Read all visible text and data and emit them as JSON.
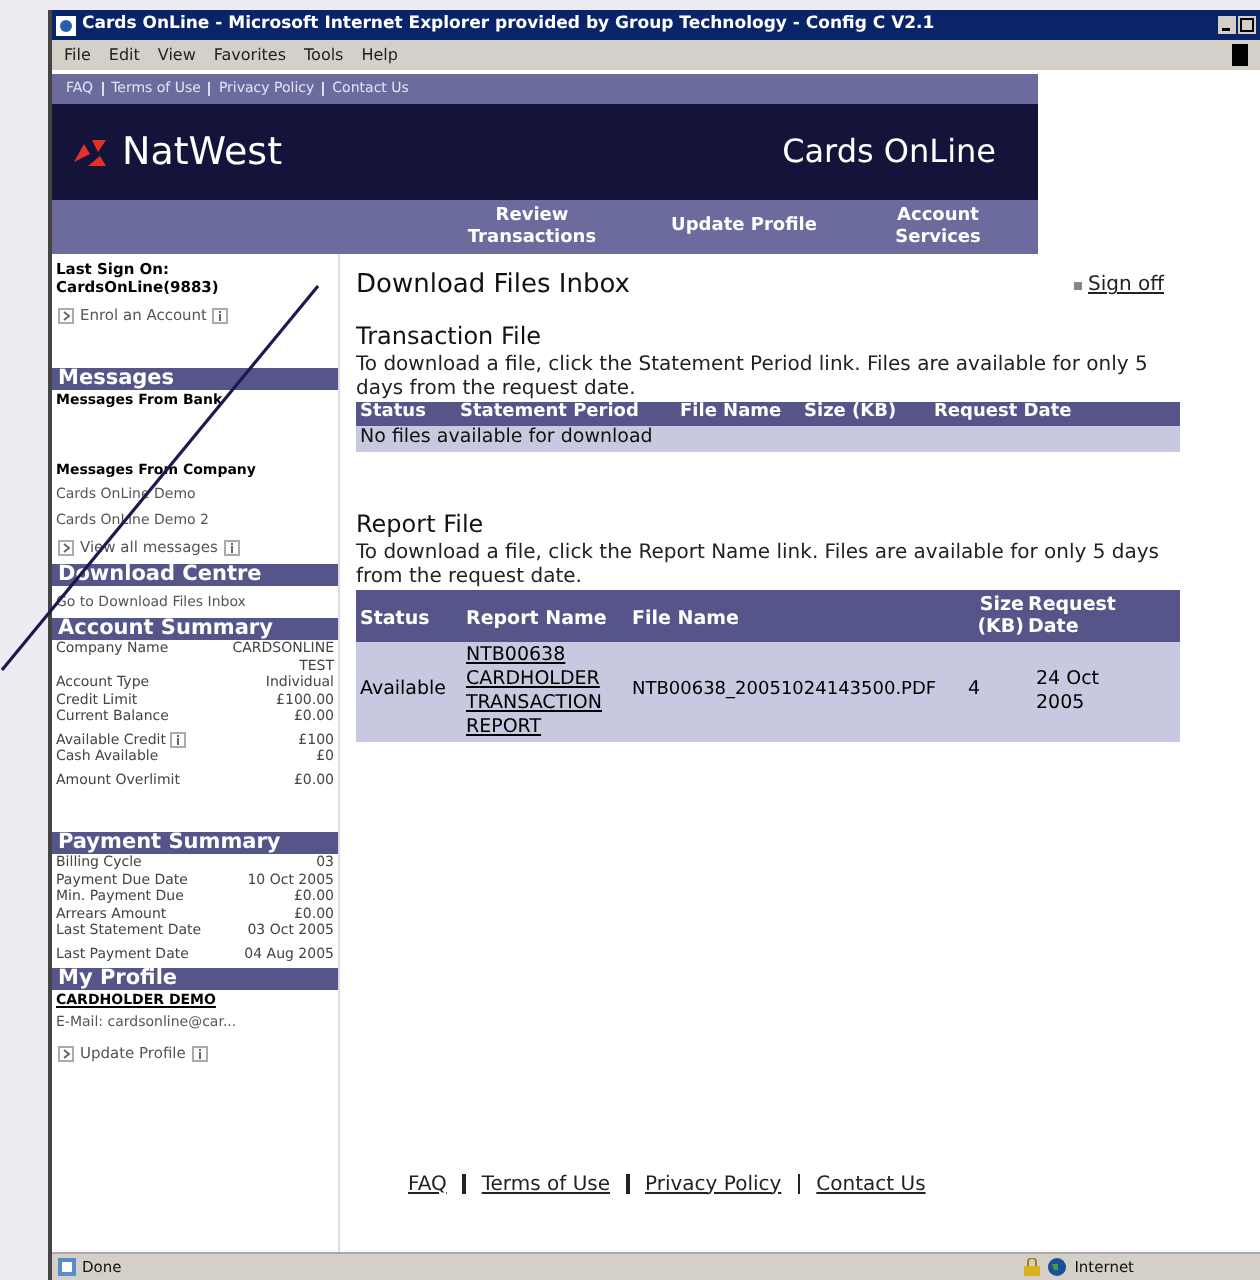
{
  "window": {
    "title": "Cards OnLine - Microsoft Internet Explorer provided by Group Technology - Config C V2.1",
    "menu": [
      "File",
      "Edit",
      "View",
      "Favorites",
      "Tools",
      "Help"
    ]
  },
  "top_links": [
    "FAQ",
    "Terms of Use",
    "Privacy Policy",
    "Contact Us"
  ],
  "brand": "NatWest",
  "product": "Cards OnLine",
  "nav": [
    "Review Transactions",
    "Update Profile",
    "Account Services"
  ],
  "sidebar": {
    "last_sign_on_label": "Last Sign On:",
    "user": "CardsOnLine(9883)",
    "enrol_link": "Enrol an Account",
    "messages": {
      "title": "Messages",
      "bank_label": "Messages From Bank",
      "company_label": "Messages From Company",
      "items": [
        "Cards OnLine Demo",
        "Cards OnLine Demo 2"
      ],
      "view_all": "View all messages"
    },
    "download": {
      "title": "Download Centre",
      "link": "Go to Download Files Inbox"
    },
    "account_summary": {
      "title": "Account Summary",
      "rows": [
        {
          "label": "Company Name",
          "value": "CARDSONLINE TEST",
          "info": false
        },
        {
          "label": "Account Type",
          "value": "Individual",
          "info": false
        },
        {
          "label": "Credit Limit",
          "value": "£100.00",
          "info": false
        },
        {
          "label": "Current Balance",
          "value": "£0.00",
          "info": false
        },
        {
          "label": "Available Credit",
          "value": "£100",
          "info": true
        },
        {
          "label": "Cash Available",
          "value": "£0",
          "info": false
        },
        {
          "label": "Amount Overlimit",
          "value": "£0.00",
          "info": false
        }
      ]
    },
    "payment_summary": {
      "title": "Payment Summary",
      "rows": [
        {
          "label": "Billing Cycle",
          "value": "03"
        },
        {
          "label": "Payment Due Date",
          "value": "10 Oct 2005"
        },
        {
          "label": "Min. Payment Due",
          "value": "£0.00"
        },
        {
          "label": "Arrears Amount",
          "value": "£0.00"
        },
        {
          "label": "Last Statement Date",
          "value": "03 Oct 2005"
        },
        {
          "label": "Last Payment Date",
          "value": "04 Aug 2005"
        }
      ]
    },
    "profile": {
      "title": "My Profile",
      "name": "CARDHOLDER DEMO",
      "email": "E-Mail: cardsonline@car...",
      "update_link": "Update Profile"
    }
  },
  "main": {
    "title": "Download Files Inbox",
    "sign_off": "Sign off",
    "transaction": {
      "title": "Transaction File",
      "text": "To download a file, click the Statement Period link. Files are available for only 5 days from the request date.",
      "columns": [
        "Status",
        "Statement Period",
        "File Name",
        "Size (KB)",
        "Request Date"
      ],
      "empty": "No files available for download"
    },
    "report": {
      "title": "Report File",
      "text": "To download a file, click the Report Name link. Files are available for only 5 days from the request date.",
      "columns": [
        "Status",
        "Report Name",
        "File Name",
        "Size (KB)",
        "Request Date"
      ],
      "rows": [
        {
          "status": "Available",
          "report_name": "NTB00638 CARDHOLDER TRANSACTION REPORT",
          "file_name": "NTB00638_20051024143500.PDF",
          "size": "4",
          "date": "24 Oct 2005"
        }
      ]
    }
  },
  "footer_links": [
    "FAQ",
    "Terms of Use",
    "Privacy Policy",
    "Contact Us"
  ],
  "status_bar": {
    "text": "Done",
    "zone": "Internet"
  }
}
